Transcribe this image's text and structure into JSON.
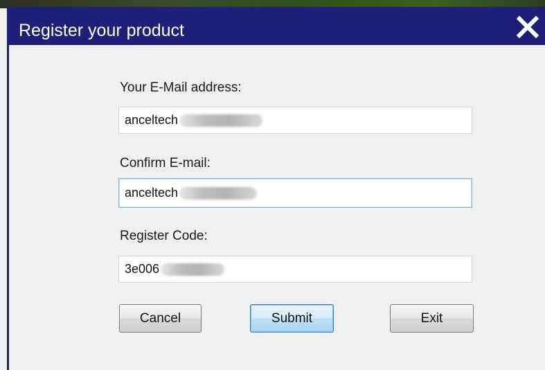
{
  "window": {
    "title": "Register your product",
    "title_bar_color": "#1f1f7a",
    "close_icon": "close-icon"
  },
  "form": {
    "email_label": "Your E-Mail address:",
    "email_value": "anceltech",
    "confirm_label": "Confirm E-mail:",
    "confirm_value": "anceltech",
    "code_label": "Register Code:",
    "code_value": "3e006"
  },
  "buttons": {
    "cancel": "Cancel",
    "submit": "Submit",
    "exit": "Exit"
  }
}
